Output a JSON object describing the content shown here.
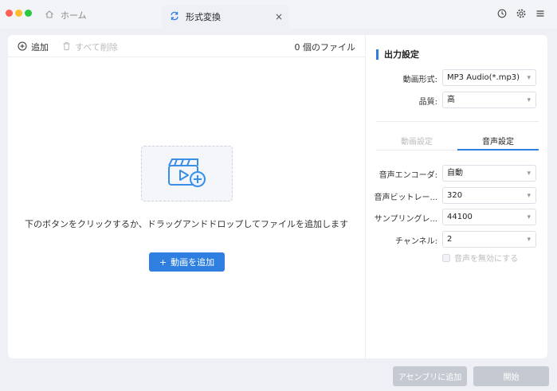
{
  "tabs": {
    "home_label": "ホーム",
    "active_label": "形式変換",
    "close_glyph": "×"
  },
  "toolbar": {
    "add_label": "追加",
    "delete_all_label": "すべて削除",
    "file_count": "0 個のファイル"
  },
  "main": {
    "hint": "下のボタンをクリックするか、ドラッグアンドドロップしてファイルを追加します",
    "add_video_label": "動画を追加",
    "plus_glyph": "+"
  },
  "output": {
    "section_title": "出力設定",
    "format_label": "動画形式:",
    "format_value": "MP3 Audio(*.mp3)",
    "quality_label": "品質:",
    "quality_value": "高",
    "tabs": [
      "動画設定",
      "音声設定"
    ],
    "active_tab": 1,
    "encoder_label": "音声エンコーダ:",
    "encoder_value": "自動",
    "bitrate_label": "音声ビットレー...",
    "bitrate_value": "320",
    "samplerate_label": "サンプリングレ...",
    "samplerate_value": "44100",
    "channel_label": "チャンネル:",
    "channel_value": "2",
    "mute_label": "音声を無効にする",
    "mute_checked": false
  },
  "bottom": {
    "assembly_label": "アセンブリに追加",
    "start_label": "開始"
  },
  "colors": {
    "accent": "#2e7fe0",
    "close_dot": "#fe5f57",
    "minimize_dot": "#febc2e",
    "zoom_dot": "#28c840",
    "disabled_button": "#c5c9d1"
  },
  "icons": {
    "chevron": "▾"
  }
}
